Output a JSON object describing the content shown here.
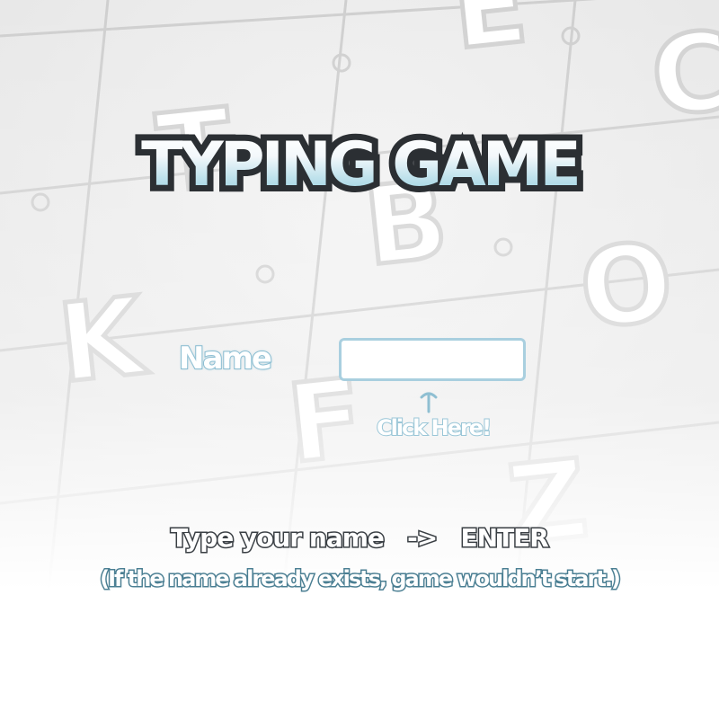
{
  "game": {
    "title": "TYPING GAME",
    "name_label": "Name",
    "name_input": {
      "value": "",
      "placeholder": ""
    },
    "click_hint": "Click Here!",
    "instruction": {
      "part1": "Type your name",
      "arrow": "->",
      "part2": "ENTER"
    },
    "note": "(If the name already exists, game wouldn’t start.)"
  },
  "background": {
    "letters": [
      "E",
      "C",
      "T",
      "B",
      "O",
      "K",
      "F",
      "Z"
    ]
  },
  "colors": {
    "title_outline": "#2b2f33",
    "title_gradient_bottom": "#9ad0e0",
    "accent_light_blue": "#a9cfdf",
    "note_outline": "#4b7f93"
  }
}
